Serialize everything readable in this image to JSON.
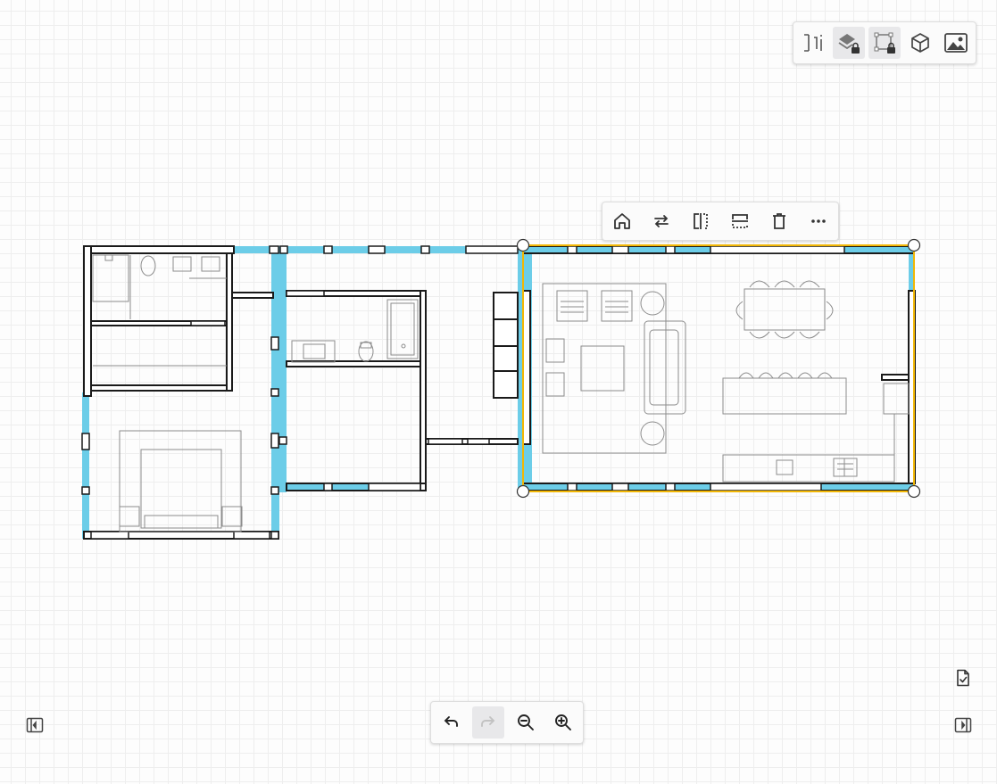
{
  "view_toolbar": {
    "buttons": [
      {
        "name": "dimensions-icon",
        "state": "normal"
      },
      {
        "name": "layers-lock-icon",
        "state": "active"
      },
      {
        "name": "room-outline-lock-icon",
        "state": "active"
      },
      {
        "name": "3d-view-icon",
        "state": "normal"
      },
      {
        "name": "image-icon",
        "state": "normal"
      }
    ]
  },
  "context_toolbar": {
    "buttons": [
      "home-icon",
      "swap-arrows-icon",
      "flip-horizontal-icon",
      "flip-vertical-icon",
      "trash-icon",
      "more-icon"
    ]
  },
  "history_toolbar": {
    "buttons": [
      {
        "name": "undo-icon",
        "enabled": true
      },
      {
        "name": "redo-icon",
        "enabled": false
      },
      {
        "name": "zoom-out-icon",
        "enabled": true
      },
      {
        "name": "zoom-in-icon",
        "enabled": true
      }
    ]
  },
  "colors": {
    "wall_highlight": "#6ccde8",
    "selection": "#f2b705",
    "wall": "#1a1a1a",
    "furniture": "#8c8c8c",
    "grid": "#eeeeee"
  },
  "corner_icons": [
    "left-panel-toggle-icon",
    "right-panel-toggle-icon",
    "checklist-icon"
  ]
}
